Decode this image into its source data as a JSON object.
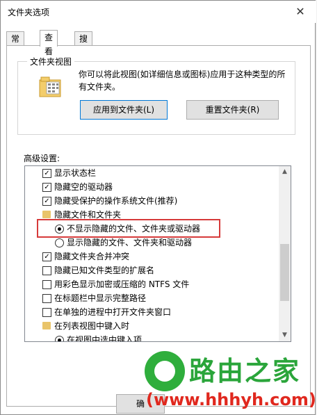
{
  "window": {
    "title": "文件夹选项"
  },
  "tabs": [
    {
      "label": "常规"
    },
    {
      "label": "查看"
    },
    {
      "label": "搜索"
    }
  ],
  "folder_views": {
    "group_label": "文件夹视图",
    "description": "你可以将此视图(如详细信息或图标)应用于这种类型的所有文件夹。",
    "apply_button": "应用到文件夹(L)",
    "reset_button": "重置文件夹(R)"
  },
  "advanced": {
    "label": "高级设置:",
    "items": [
      {
        "text": "显示状态栏",
        "type": "checkbox",
        "checked": true
      },
      {
        "text": "隐藏空的驱动器",
        "type": "checkbox",
        "checked": true
      },
      {
        "text": "隐藏受保护的操作系统文件(推荐)",
        "type": "checkbox",
        "checked": true
      },
      {
        "text": "隐藏文件和文件夹",
        "type": "folder"
      },
      {
        "text": "不显示隐藏的文件、文件夹或驱动器",
        "type": "radio",
        "checked": true
      },
      {
        "text": "显示隐藏的文件、文件夹和驱动器",
        "type": "radio",
        "checked": false
      },
      {
        "text": "隐藏文件夹合并冲突",
        "type": "checkbox",
        "checked": true
      },
      {
        "text": "隐藏已知文件类型的扩展名",
        "type": "checkbox",
        "checked": false
      },
      {
        "text": "用彩色显示加密或压缩的 NTFS 文件",
        "type": "checkbox",
        "checked": false
      },
      {
        "text": "在标题栏中显示完整路径",
        "type": "checkbox",
        "checked": false
      },
      {
        "text": "在单独的进程中打开文件夹窗口",
        "type": "checkbox",
        "checked": false
      },
      {
        "text": "在列表视图中键入时",
        "type": "folder"
      },
      {
        "text": "在视图中选中键入项",
        "type": "radio",
        "checked": true
      }
    ]
  },
  "watermark": {
    "title": "路由之家",
    "url": "(www.hhhyh.com)"
  },
  "buttons": {
    "ok_partial": "确"
  },
  "colors": {
    "highlight": "#d63a3a",
    "watermark_green": "#2aa53a",
    "watermark_red": "#e0281e"
  }
}
